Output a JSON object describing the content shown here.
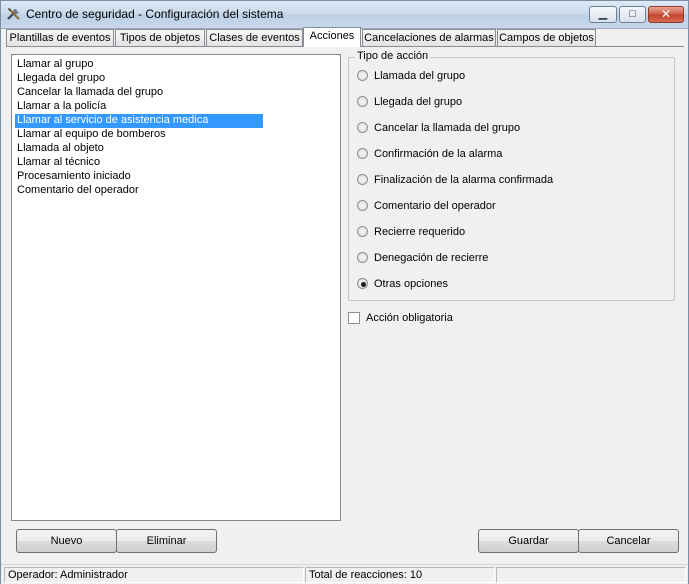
{
  "window": {
    "title": "Centro de seguridad - Configuración del sistema",
    "app_icon": "tools-icon",
    "minimize_icon": "minimize-icon",
    "maximize_icon": "maximize-icon",
    "close_icon": "close-icon"
  },
  "tabs": [
    {
      "label": "Plantillas de eventos"
    },
    {
      "label": "Tipos de objetos"
    },
    {
      "label": "Clases de eventos"
    },
    {
      "label": "Acciones"
    },
    {
      "label": "Cancelaciones de alarmas"
    },
    {
      "label": "Campos de objetos"
    }
  ],
  "active_tab": "Acciones",
  "actions_list": {
    "items": [
      "Llamar al grupo",
      "Llegada del grupo",
      "Cancelar la llamada del grupo",
      "Llamar a la policía",
      "Llamar al servicio de asistencia medica",
      "Llamar al equipo de bomberos",
      "Llamada al objeto",
      "Llamar al técnico",
      "Procesamiento iniciado",
      "Comentario del operador"
    ],
    "selected": "Llamar al servicio de asistencia medica",
    "selection_color": "#3399ff"
  },
  "action_type": {
    "legend": "Tipo de acción",
    "options": [
      "Llamada del grupo",
      "Llegada del grupo",
      "Cancelar la llamada del grupo",
      "Confirmación de la alarma",
      "Finalización de la alarma confirmada",
      "Comentario del operador",
      "Recierre requerido",
      "Denegación de recierre",
      "Otras opciones"
    ],
    "selected": "Otras opciones"
  },
  "mandatory_action": {
    "label": "Acción obligatoria",
    "checked": false
  },
  "buttons": {
    "new": "Nuevo",
    "delete": "Eliminar",
    "save": "Guardar",
    "cancel": "Cancelar"
  },
  "status": {
    "operator": "Operador: Administrador",
    "reactions": "Total de reacciones: 10",
    "extra": ""
  }
}
